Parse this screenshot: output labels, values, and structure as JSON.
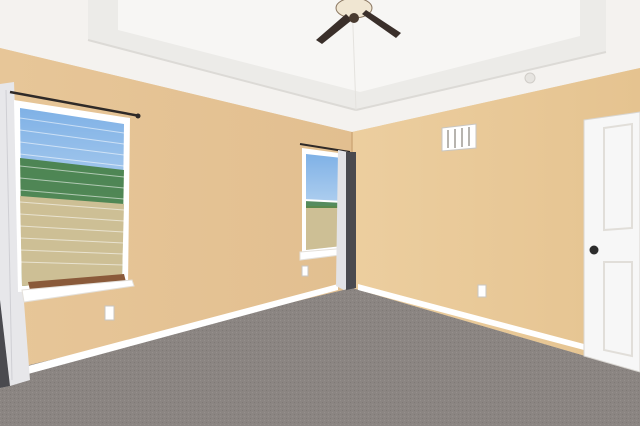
{
  "scene": {
    "subject": "empty-bedroom",
    "colors": {
      "wall": "#e9c99c",
      "wall_shadow": "#ddb988",
      "ceiling": "#f3f1ee",
      "carpet": "#8a8581",
      "trim": "#ffffff",
      "sky": "#9cc3ec",
      "trees": "#3f7a3a",
      "fence": "#cdbf95",
      "curtain": "#e7e7ea",
      "curtain_dark": "#4a4a4f",
      "fan": "#3a2f2a",
      "door": "#f7f7f7"
    },
    "elements": [
      "tray-ceiling",
      "ceiling-fan",
      "left-window",
      "middle-window",
      "hvac-vent",
      "door",
      "carpet-floor"
    ]
  }
}
